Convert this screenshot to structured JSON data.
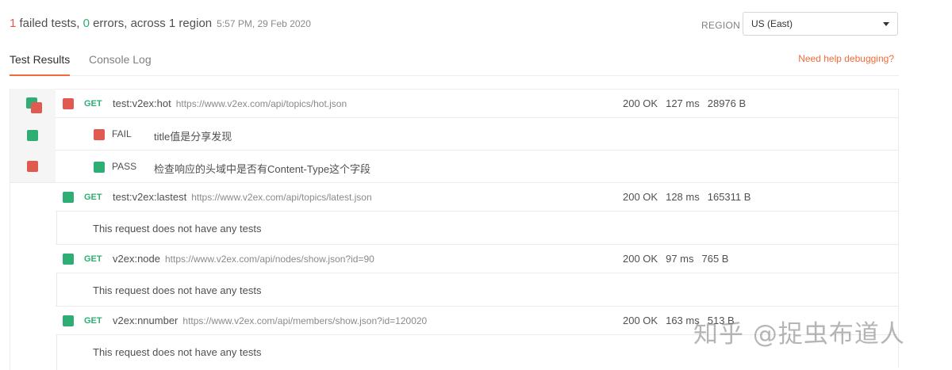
{
  "summary": {
    "failed_count": "1",
    "failed_text": " failed tests, ",
    "error_count": "0",
    "error_text": " errors, across 1 region",
    "timestamp": "5:57 PM, 29 Feb 2020"
  },
  "region": {
    "label": "REGION",
    "selected": "US (East)"
  },
  "tabs": [
    {
      "label": "Test Results",
      "active": true
    },
    {
      "label": "Console Log",
      "active": false
    }
  ],
  "help_link": "Need help debugging?",
  "requests": [
    {
      "method": "GET",
      "name": "test:v2ex:hot",
      "url": "https://www.v2ex.com/api/topics/hot.json",
      "status": "200 OK",
      "time": "127 ms",
      "size": "28976 B",
      "result": "fail",
      "tests": [
        {
          "status": "FAIL",
          "name": "title值是分享发现"
        },
        {
          "status": "PASS",
          "name": "检查响应的头域中是否有Content-Type这个字段"
        }
      ]
    },
    {
      "method": "GET",
      "name": "test:v2ex:lastest",
      "url": "https://www.v2ex.com/api/topics/latest.json",
      "status": "200 OK",
      "time": "128 ms",
      "size": "165311 B",
      "result": "pass",
      "note": "This request does not have any tests"
    },
    {
      "method": "GET",
      "name": "v2ex:node",
      "url": "https://www.v2ex.com/api/nodes/show.json?id=90",
      "status": "200 OK",
      "time": "97 ms",
      "size": "765 B",
      "result": "pass",
      "note": "This request does not have any tests"
    },
    {
      "method": "GET",
      "name": "v2ex:nnumber",
      "url": "https://www.v2ex.com/api/members/show.json?id=120020",
      "status": "200 OK",
      "time": "163 ms",
      "size": "513 B",
      "result": "pass",
      "note": "This request does not have any tests"
    }
  ],
  "watermark": "知乎 @捉虫布道人",
  "colors": {
    "accent": "#f26b3a",
    "pass": "#2eae74",
    "fail": "#e05a4f"
  }
}
